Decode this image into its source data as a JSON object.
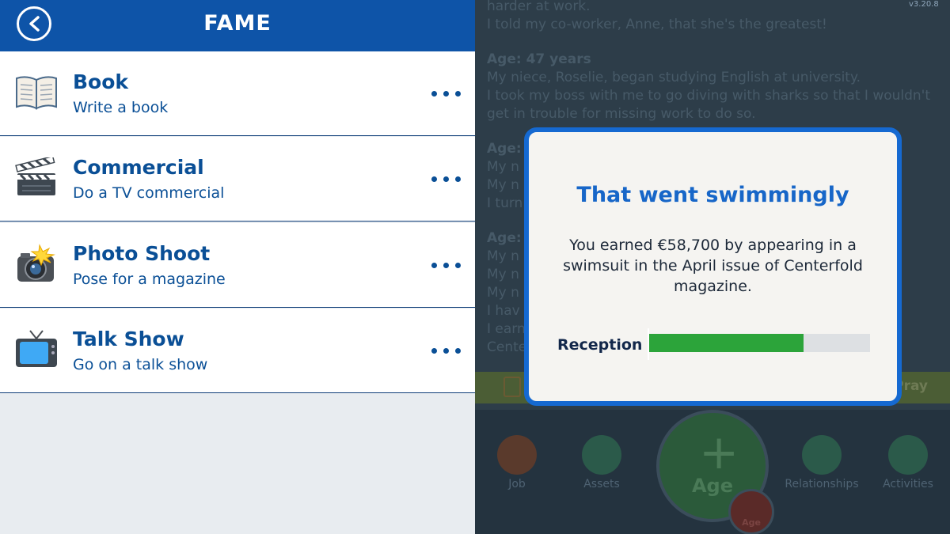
{
  "header": {
    "title": "FAME"
  },
  "version": "v3.20.8",
  "activities": [
    {
      "name": "Book",
      "description": "Write a book",
      "icon": "book-icon"
    },
    {
      "name": "Commercial",
      "description": "Do a TV commercial",
      "icon": "clapperboard-icon"
    },
    {
      "name": "Photo Shoot",
      "description": "Pose for a magazine",
      "icon": "camera-flash-icon"
    },
    {
      "name": "Talk Show",
      "description": "Go on a talk show",
      "icon": "television-icon"
    }
  ],
  "life_log": {
    "lines": [
      "harder at work.",
      "I told my co-worker, Anne, that she's the greatest!"
    ],
    "age_header": "Age: 47 years",
    "age_lines": [
      "My niece, Roselie, began studying English at university.",
      "I took my boss with me to go diving with sharks so that I wouldn't",
      "get in trouble for missing work to do so."
    ],
    "fragments": [
      "Age:",
      "My n",
      "My n",
      "I turn",
      "Age:",
      "My n",
      "My n",
      "My n",
      "I hav",
      "I earn",
      "Cente"
    ]
  },
  "action_bar": {
    "right_label": "Pray"
  },
  "bottom_nav": {
    "items": [
      {
        "label": "Job",
        "color": "#5a3a2c"
      },
      {
        "label": "Assets",
        "color": "#2b5a4a"
      },
      {
        "label": "Relationships",
        "color": "#2b5a4a"
      },
      {
        "label": "Activities",
        "color": "#2b5a4a"
      }
    ],
    "age_label": "Age",
    "age_small_label": "Age"
  },
  "modal": {
    "title": "That went swimmingly",
    "body": "You earned €58,700 by appearing in a swimsuit in the April issue of Centerfold magazine.",
    "reception_label": "Reception",
    "reception_value": 0.7,
    "reception_color": "#2ca43a"
  }
}
